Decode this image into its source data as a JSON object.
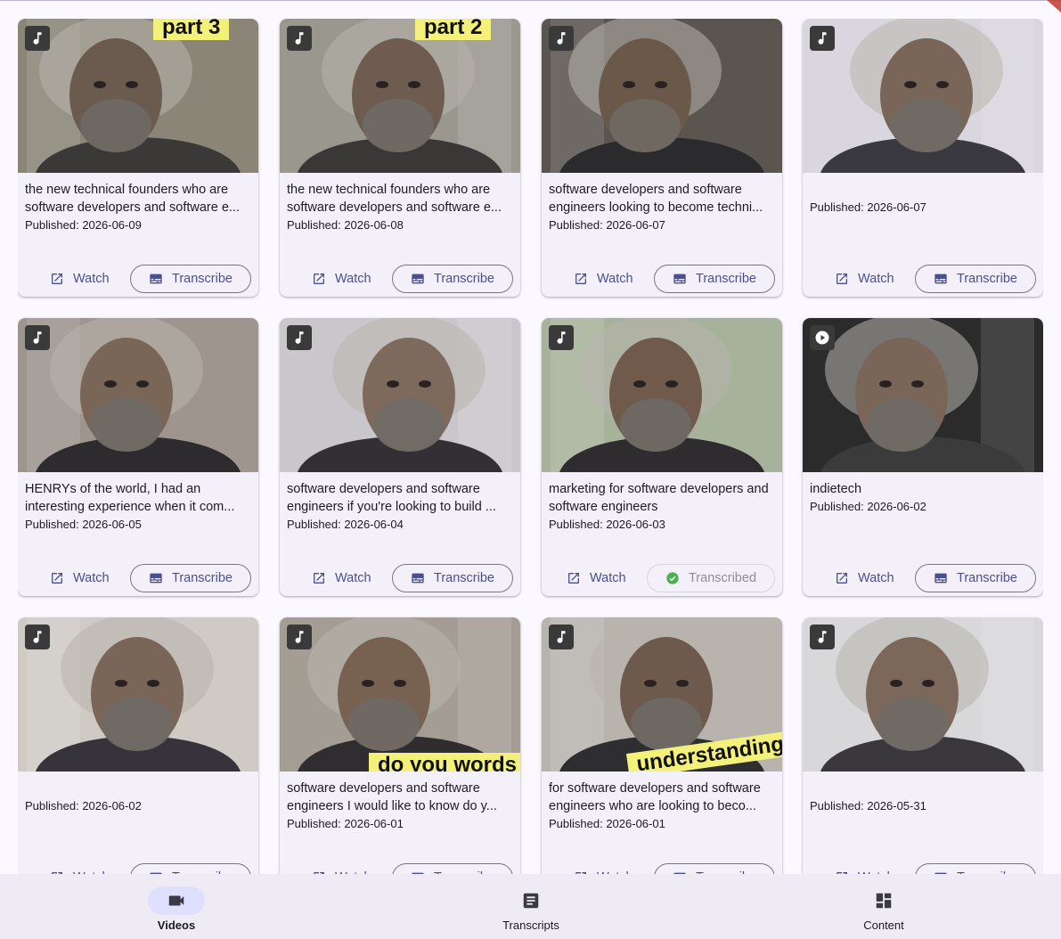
{
  "colors": {
    "accent": "#4a4f8e",
    "active_pill": "#dfe0ff",
    "success": "#4caf50",
    "background": "#fbf8ff",
    "card": "#f4f0fa"
  },
  "videos": [
    {
      "badge_icon": "music-note-icon",
      "overlay_text": "part 3",
      "title": "the new technical founders who are software developers and software e...",
      "published": "Published: 2026-06-09",
      "watch_label": "Watch",
      "transcribe_label": "Transcribe",
      "transcribed": false
    },
    {
      "badge_icon": "music-note-icon",
      "overlay_text": "part 2",
      "title": "the new technical founders who are software developers and software e...",
      "published": "Published: 2026-06-08",
      "watch_label": "Watch",
      "transcribe_label": "Transcribe",
      "transcribed": false
    },
    {
      "badge_icon": "music-note-icon",
      "overlay_text": "",
      "title": "software developers and software engineers looking to become techni...",
      "published": "Published: 2026-06-07",
      "watch_label": "Watch",
      "transcribe_label": "Transcribe",
      "transcribed": false
    },
    {
      "badge_icon": "music-note-icon",
      "overlay_text": "",
      "title": "",
      "published": "Published: 2026-06-07",
      "watch_label": "Watch",
      "transcribe_label": "Transcribe",
      "transcribed": false
    },
    {
      "badge_icon": "music-note-icon",
      "overlay_text": "",
      "title": "HENRYs of the world, I had an interesting experience when it com...",
      "published": "Published: 2026-06-05",
      "watch_label": "Watch",
      "transcribe_label": "Transcribe",
      "transcribed": false
    },
    {
      "badge_icon": "music-note-icon",
      "overlay_text": "",
      "title": "software developers and software engineers if you're looking to build ...",
      "published": "Published: 2026-06-04",
      "watch_label": "Watch",
      "transcribe_label": "Transcribe",
      "transcribed": false
    },
    {
      "badge_icon": "music-note-icon",
      "overlay_text": "",
      "title": "marketing for software developers and software engineers",
      "published": "Published: 2026-06-03",
      "watch_label": "Watch",
      "transcribe_label": "Transcribed",
      "transcribed": true
    },
    {
      "badge_icon": "play-circle-icon",
      "overlay_text": "",
      "title": "indietech",
      "published": "Published: 2026-06-02",
      "watch_label": "Watch",
      "transcribe_label": "Transcribe",
      "transcribed": false
    },
    {
      "badge_icon": "music-note-icon",
      "overlay_text": "",
      "title": "",
      "published": "Published: 2026-06-02",
      "watch_label": "Watch",
      "transcribe_label": "Transcribe",
      "transcribed": false
    },
    {
      "badge_icon": "music-note-icon",
      "overlay_text": "do you words",
      "title": "software developers and software engineers I would like to know do y...",
      "published": "Published: 2026-06-01",
      "watch_label": "Watch",
      "transcribe_label": "Transcribe",
      "transcribed": false
    },
    {
      "badge_icon": "music-note-icon",
      "overlay_text": "understanding",
      "title": "for software developers and software engineers who are looking to beco...",
      "published": "Published: 2026-06-01",
      "watch_label": "Watch",
      "transcribe_label": "Transcribe",
      "transcribed": false
    },
    {
      "badge_icon": "music-note-icon",
      "overlay_text": "",
      "title": "",
      "published": "Published: 2026-05-31",
      "watch_label": "Watch",
      "transcribe_label": "Transcribe",
      "transcribed": false
    }
  ],
  "bottom_nav": [
    {
      "label": "Videos",
      "icon": "videocam-icon",
      "active": true
    },
    {
      "label": "Transcripts",
      "icon": "article-icon",
      "active": false
    },
    {
      "label": "Content",
      "icon": "dashboard-icon",
      "active": false
    }
  ]
}
